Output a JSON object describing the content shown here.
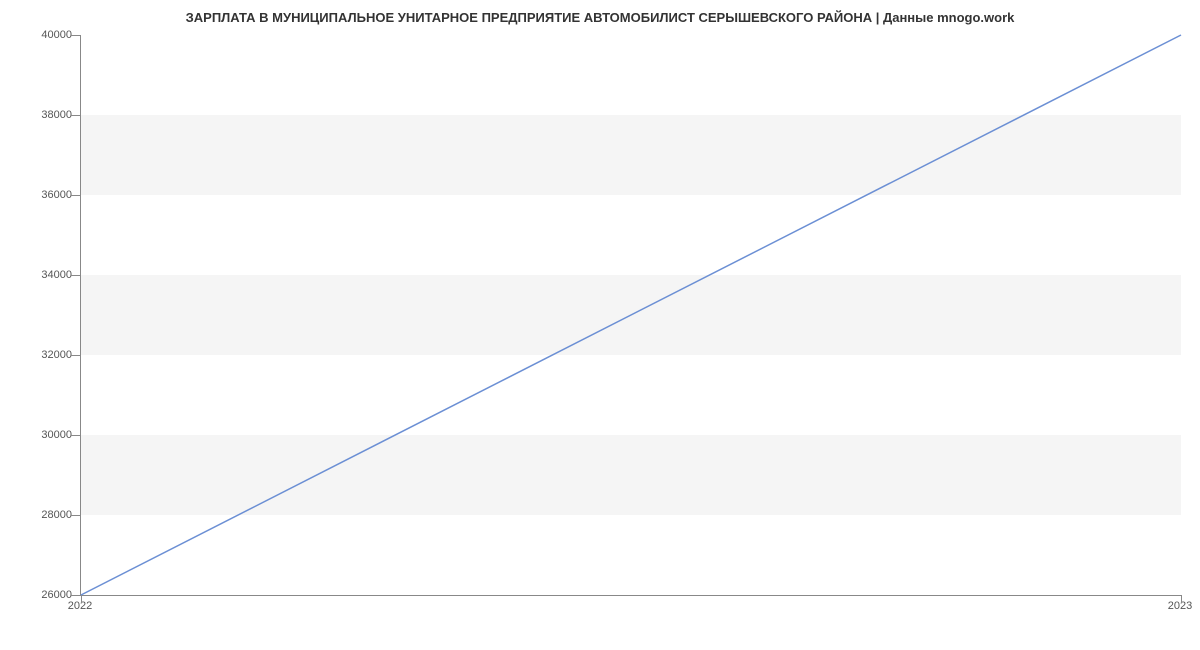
{
  "chart_data": {
    "type": "line",
    "title": "ЗАРПЛАТА В МУНИЦИПАЛЬНОЕ УНИТАРНОЕ ПРЕДПРИЯТИЕ АВТОМОБИЛИСТ СЕРЫШЕВСКОГО РАЙОНА | Данные mnogo.work",
    "x": [
      "2022",
      "2023"
    ],
    "values": [
      26000,
      40000
    ],
    "xlabel": "",
    "ylabel": "",
    "ylim": [
      26000,
      40000
    ],
    "y_ticks": [
      26000,
      28000,
      30000,
      32000,
      34000,
      36000,
      38000,
      40000
    ],
    "line_color": "#6b8fd4"
  }
}
